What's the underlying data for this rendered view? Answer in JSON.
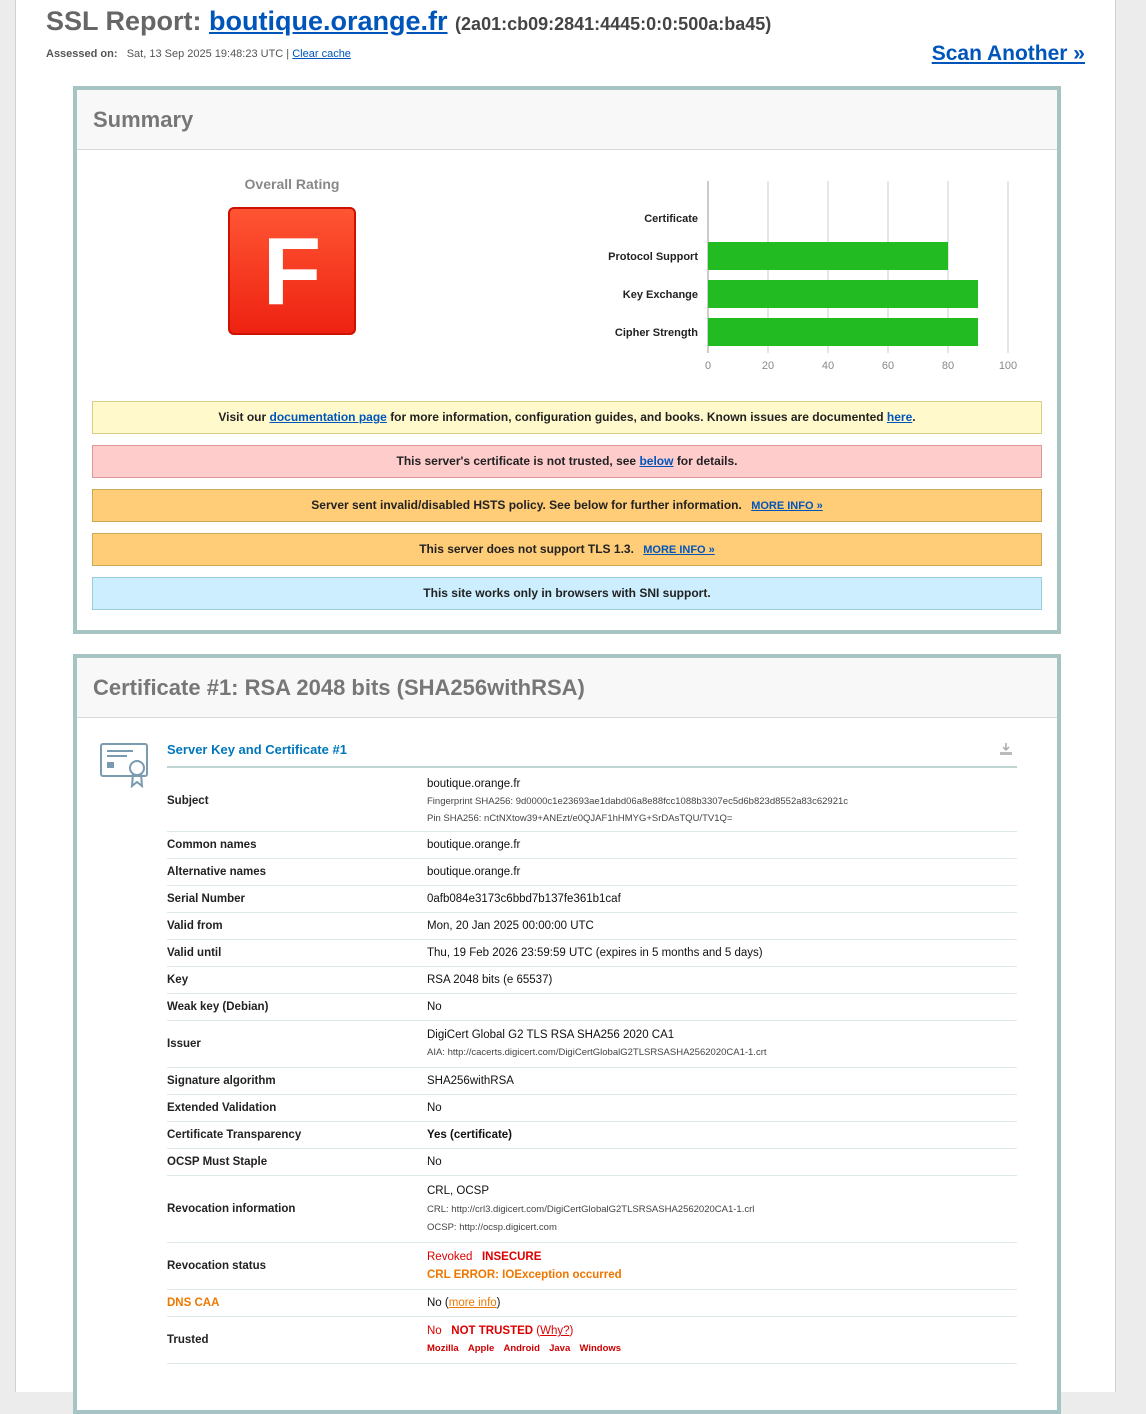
{
  "header": {
    "title_prefix": "SSL Report:",
    "hostname": "boutique.orange.fr",
    "ip": "(2a01:cb09:2841:4445:0:0:500a:ba45)",
    "assessed_label": "Assessed on:",
    "assessed_value": "Sat, 13 Sep 2025 19:48:23 UTC |",
    "clear_cache": "Clear cache",
    "scan_another": "Scan Another »"
  },
  "summary": {
    "title": "Summary",
    "overall_label": "Overall Rating",
    "grade": "F",
    "grade_color": "#ee2211",
    "notices": {
      "doc_prefix": "Visit our",
      "doc_link": "documentation page",
      "doc_middle": "for more information, configuration guides, and books. Known issues are documented",
      "doc_link2": "here",
      "doc_suffix": ".",
      "trust_prefix": "This server's certificate is not trusted, see",
      "trust_link": "below",
      "trust_suffix": "for details.",
      "hsts_text": "Server sent invalid/disabled HSTS policy. See below for further information.",
      "hsts_more": "MORE INFO »",
      "tls_text": "This server does not support TLS 1.3.",
      "tls_more": "MORE INFO »",
      "sni_text": "This site works only in browsers with SNI support."
    }
  },
  "chart_data": {
    "type": "bar",
    "orientation": "horizontal",
    "categories": [
      "Certificate",
      "Protocol Support",
      "Key Exchange",
      "Cipher Strength"
    ],
    "values": [
      0,
      80,
      90,
      90
    ],
    "xlim": [
      0,
      100
    ],
    "xticks": [
      0,
      20,
      40,
      60,
      80,
      100
    ],
    "bar_color": "#22bb22",
    "grid": true
  },
  "certificate": {
    "title": "Certificate #1: RSA 2048 bits (SHA256withRSA)",
    "section_title": "Server Key and Certificate #1",
    "subject": {
      "label": "Subject",
      "value": "boutique.orange.fr",
      "fingerprint": "Fingerprint SHA256: 9d0000c1e23693ae1dabd06a8e88fcc1088b3307ec5d6b823d8552a83c62921c",
      "pin": "Pin SHA256: nCtNXtow39+ANEzt/e0QJAF1hHMYG+SrDAsTQU/TV1Q="
    },
    "common_names": {
      "label": "Common names",
      "value": "boutique.orange.fr"
    },
    "alt_names": {
      "label": "Alternative names",
      "value": "boutique.orange.fr"
    },
    "serial": {
      "label": "Serial Number",
      "value": "0afb084e3173c6bbd7b137fe361b1caf"
    },
    "valid_from": {
      "label": "Valid from",
      "value": "Mon, 20 Jan 2025 00:00:00 UTC"
    },
    "valid_until": {
      "label": "Valid until",
      "value": "Thu, 19 Feb 2026 23:59:59 UTC (expires in 5 months and 5 days)"
    },
    "key": {
      "label": "Key",
      "value": "RSA 2048 bits (e 65537)"
    },
    "weak_key": {
      "label": "Weak key (Debian)",
      "value": "No"
    },
    "issuer": {
      "label": "Issuer",
      "value": "DigiCert Global G2 TLS RSA SHA256 2020 CA1",
      "aia": "AIA: http://cacerts.digicert.com/DigiCertGlobalG2TLSRSASHA2562020CA1-1.crt"
    },
    "sig_alg": {
      "label": "Signature algorithm",
      "value": "SHA256withRSA"
    },
    "ev": {
      "label": "Extended Validation",
      "value": "No"
    },
    "ct": {
      "label": "Certificate Transparency",
      "value": "Yes (certificate)"
    },
    "ocsp_staple": {
      "label": "OCSP Must Staple",
      "value": "No"
    },
    "revocation_info": {
      "label": "Revocation information",
      "value": "CRL, OCSP",
      "crl": "CRL: http://crl3.digicert.com/DigiCertGlobalG2TLSRSASHA2562020CA1-1.crl",
      "ocsp": "OCSP: http://ocsp.digicert.com"
    },
    "revocation_status": {
      "label": "Revocation status",
      "value": "Revoked",
      "flag": "INSECURE",
      "error": "CRL ERROR: IOException occurred"
    },
    "dns_caa": {
      "label": "DNS CAA",
      "value": "No (",
      "link": "more info",
      "suffix": ")"
    },
    "trusted": {
      "label": "Trusted",
      "value": "No",
      "flag": "NOT TRUSTED",
      "why_prefix": "(",
      "why": "Why?",
      "why_suffix": ")",
      "stores": [
        "Mozilla",
        "Apple",
        "Android",
        "Java",
        "Windows"
      ]
    }
  },
  "colors": {
    "box_border": "#a6c4c4",
    "link": "#0055bb",
    "section_title": "#0077bb",
    "warning_red": "#dd0000",
    "warning_orange": "#ee7700",
    "good_green": "#228800"
  }
}
